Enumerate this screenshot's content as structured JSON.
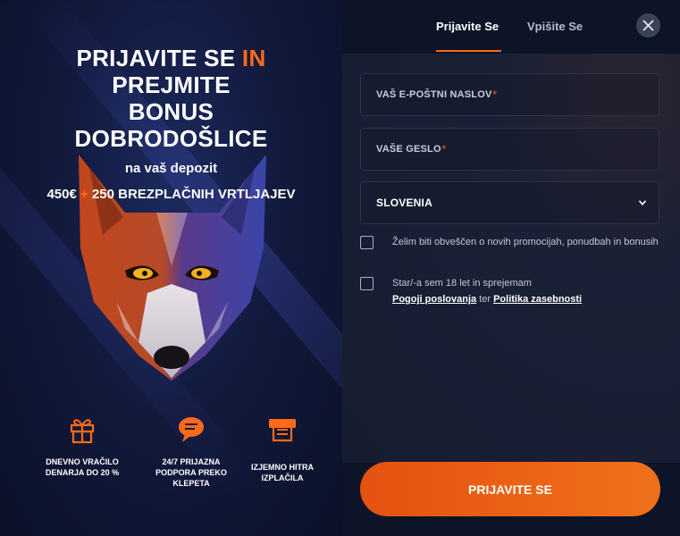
{
  "promo": {
    "headline_line1_a": "PRIJAVITE SE ",
    "headline_line1_b": "IN",
    "headline_line2": "PREJMITE",
    "headline_line3": "BONUS",
    "headline_line4": "DOBRODOŠLICE",
    "subtitle": "na vaš depozit",
    "bonus_a": "450€",
    "bonus_plus": "+",
    "bonus_b": "250 BREZPLAČNIH VRTLJAJEV",
    "features": [
      {
        "icon": "gift-icon",
        "label": "DNEVNO VRAČILO DENARJA DO 20 %"
      },
      {
        "icon": "chat-bubble-icon",
        "label": "24/7 PRIJAZNA PODPORA PREKO KLEPETA"
      },
      {
        "icon": "cash-out-icon",
        "label": "IZJEMNO HITRA IZPLAČILA"
      }
    ]
  },
  "tabs": {
    "login": "Prijavite Se",
    "register": "Vpišite Se"
  },
  "form": {
    "email_placeholder": "VAŠ E-POŠTNI NASLOV",
    "password_placeholder": "VAŠE GESLO",
    "required_mark": "*",
    "country_value": "SLOVENIA",
    "promo_checkbox_label": "Želim biti obveščen o novih promocijah, ponudbah in bonusih",
    "terms_prefix": "Star/-a sem 18 let in sprejemam",
    "terms_link": "Pogoji poslovanja",
    "terms_mid": " ter ",
    "privacy_link": "Politika zasebnosti",
    "submit_label": "PRIJAVITE SE"
  },
  "colors": {
    "accent": "#ff6a1a",
    "background": "#0d1428",
    "panel": "#161d31"
  }
}
